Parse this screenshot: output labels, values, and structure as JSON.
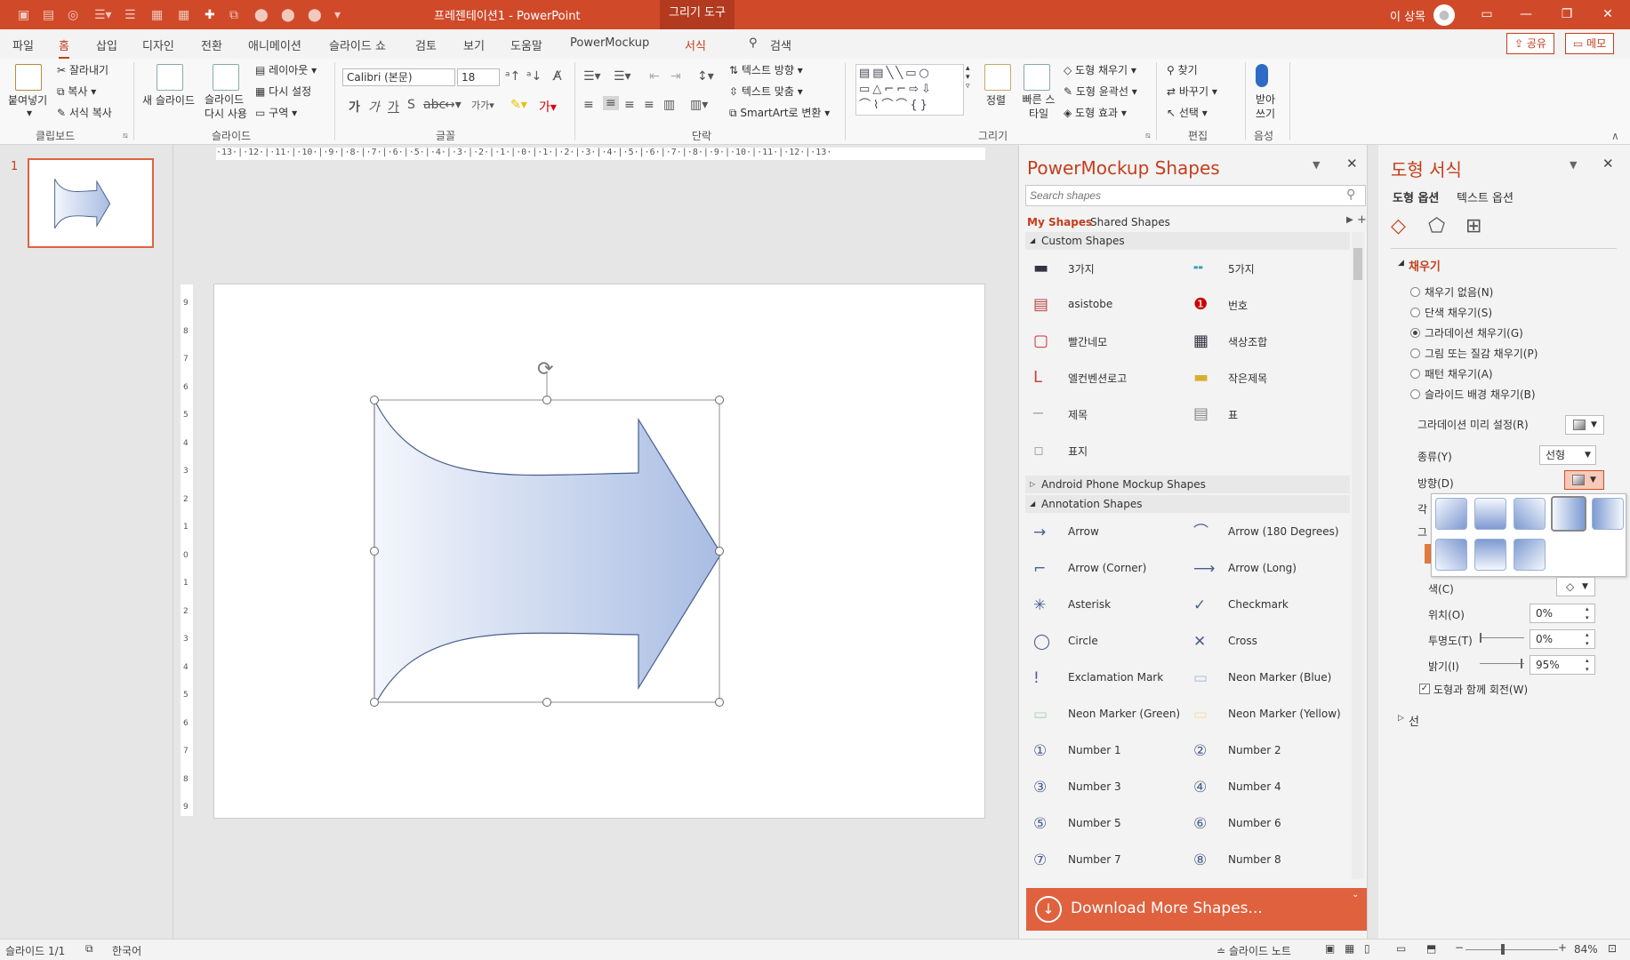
{
  "titlebar": {
    "doc_title": "프레젠테이션1  -  PowerPoint",
    "context_tab": "그리기 도구",
    "user": "이 상목"
  },
  "menu": {
    "tabs": [
      "파일",
      "홈",
      "삽입",
      "디자인",
      "전환",
      "애니메이션",
      "슬라이드 쇼",
      "검토",
      "보기",
      "도움말",
      "PowerMockup",
      "서식"
    ],
    "search": "검색",
    "share": "공유",
    "memo": "메모"
  },
  "ribbon": {
    "clipboard": {
      "paste": "붙여넣기",
      "cut": "잘라내기",
      "copy": "복사",
      "format_painter": "서식 복사",
      "label": "클립보드"
    },
    "slides": {
      "new_slide": "새 슬라이드",
      "reuse": "슬라이드 다시 사용",
      "layout": "레이아웃",
      "reset": "다시 설정",
      "section": "구역",
      "label": "슬라이드"
    },
    "font": {
      "name": "Calibri (본문)",
      "size": "18",
      "label": "글꼴"
    },
    "paragraph": {
      "text_direction": "텍스트 방향",
      "align_text": "텍스트 맞춤",
      "smartart": "SmartArt로 변환",
      "label": "단락"
    },
    "drawing": {
      "arrange": "정렬",
      "quick_styles": "빠른 스타일",
      "fill": "도형 채우기",
      "outline": "도형 윤곽선",
      "effects": "도형 효과",
      "label": "그리기"
    },
    "editing": {
      "find": "찾기",
      "replace": "바꾸기",
      "select": "선택",
      "label": "편집"
    },
    "voice": {
      "dictate": "받아쓰기",
      "label": "음성"
    }
  },
  "slide_panel": {
    "number": "1"
  },
  "ruler_h": "·13·|·12·|·11·|·10·|·9·|·8·|·7·|·6·|·5·|·4·|·3·|·2·|·1·|·0·|·1·|·2·|·3·|·4·|·5·|·6·|·7·|·8·|·9·|·10·|·11·|·12·|·13·",
  "ruler_v": [
    "9",
    "8",
    "7",
    "6",
    "5",
    "4",
    "3",
    "2",
    "1",
    "0",
    "1",
    "2",
    "3",
    "4",
    "5",
    "6",
    "7",
    "8",
    "9"
  ],
  "shapes_pane": {
    "title": "PowerMockup Shapes",
    "search_placeholder": "Search shapes",
    "tab_my": "My Shapes",
    "tab_shared": "Shared Shapes",
    "sections": {
      "custom": "Custom Shapes",
      "android": "Android Phone Mockup Shapes",
      "annotation": "Annotation Shapes"
    },
    "custom_items": [
      "3가지",
      "5가지",
      "asistobe",
      "번호",
      "빨간네모",
      "색상조합",
      "엘컨벤션로고",
      "작은제목",
      "제목",
      "표",
      "표지"
    ],
    "annotation_items": [
      "Arrow",
      "Arrow (180 Degrees)",
      "Arrow (Corner)",
      "Arrow (Long)",
      "Asterisk",
      "Checkmark",
      "Circle",
      "Cross",
      "Exclamation Mark",
      "Neon Marker (Blue)",
      "Neon Marker (Green)",
      "Neon Marker (Yellow)",
      "Number 1",
      "Number 2",
      "Number 3",
      "Number 4",
      "Number 5",
      "Number 6",
      "Number 7",
      "Number 8"
    ],
    "download": "Download More Shapes..."
  },
  "format_pane": {
    "title": "도형 서식",
    "tab_shape": "도형 옵션",
    "tab_text": "텍스트 옵션",
    "fill_section": "채우기",
    "fill_options": [
      "채우기 없음(N)",
      "단색 채우기(S)",
      "그라데이션 채우기(G)",
      "그림 또는 질감 채우기(P)",
      "패턴 채우기(A)",
      "슬라이드 배경 채우기(B)"
    ],
    "preset_label": "그라데이션 미리 설정(R)",
    "type_label": "종류(Y)",
    "type_value": "선형",
    "direction_label": "방향(D)",
    "color_label": "색(C)",
    "position_label": "위치(O)",
    "position_value": "0%",
    "transparency_label": "투명도(T)",
    "transparency_value": "0%",
    "brightness_label": "밝기(I)",
    "brightness_value": "95%",
    "rotate_label": "도형과 함께 회전(W)",
    "line_section": "선",
    "partial_1": "각",
    "partial_2": "그"
  },
  "status": {
    "slide": "슬라이드 1/1",
    "lang": "한국어",
    "notes": "슬라이드 노트",
    "zoom": "84%"
  },
  "colors": {
    "accent": "#d04a2a",
    "arrow_fill_start": "#f3f6fc",
    "arrow_fill_end": "#a9bde3",
    "arrow_stroke": "#4a5f8f"
  }
}
